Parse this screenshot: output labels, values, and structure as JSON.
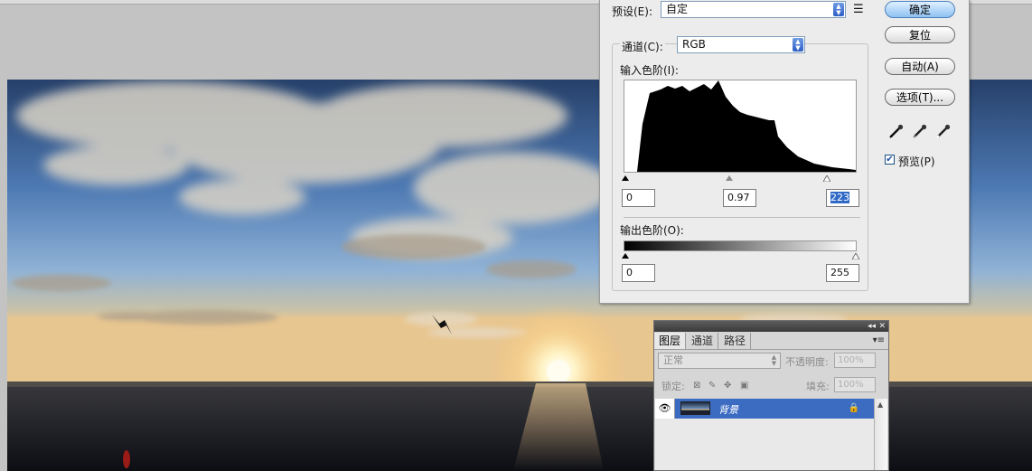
{
  "levels": {
    "preset_label": "预设(E):",
    "preset_value": "自定",
    "channel_label": "通道(C):",
    "channel_value": "RGB",
    "input_levels_label": "输入色阶(I):",
    "input_black": "0",
    "input_gamma": "0.97",
    "input_white": "223",
    "output_levels_label": "输出色阶(O):",
    "output_black": "0",
    "output_white": "255",
    "buttons": {
      "ok": "确定",
      "reset": "复位",
      "auto": "自动(A)",
      "options": "选项(T)..."
    },
    "preview_label": "预览(P)",
    "preview_checked": true
  },
  "layers_panel": {
    "tabs": [
      "图层",
      "通道",
      "路径"
    ],
    "active_tab": "图层",
    "blend_mode": "正常",
    "opacity_label": "不透明度:",
    "opacity_value": "100%",
    "lock_label": "锁定:",
    "fill_label": "填充:",
    "fill_value": "100%",
    "layer_name": "背景"
  },
  "icons": {
    "presets_menu": "list-menu-icon",
    "eyedroppers": [
      "black-eyedropper-icon",
      "gray-eyedropper-icon",
      "white-eyedropper-icon"
    ],
    "visibility": "eye-icon",
    "lock": "lock-icon"
  },
  "colors": {
    "accent": "#3c6bc2",
    "primary_button": "#8fc1f2",
    "dialog_bg": "#ececec"
  }
}
